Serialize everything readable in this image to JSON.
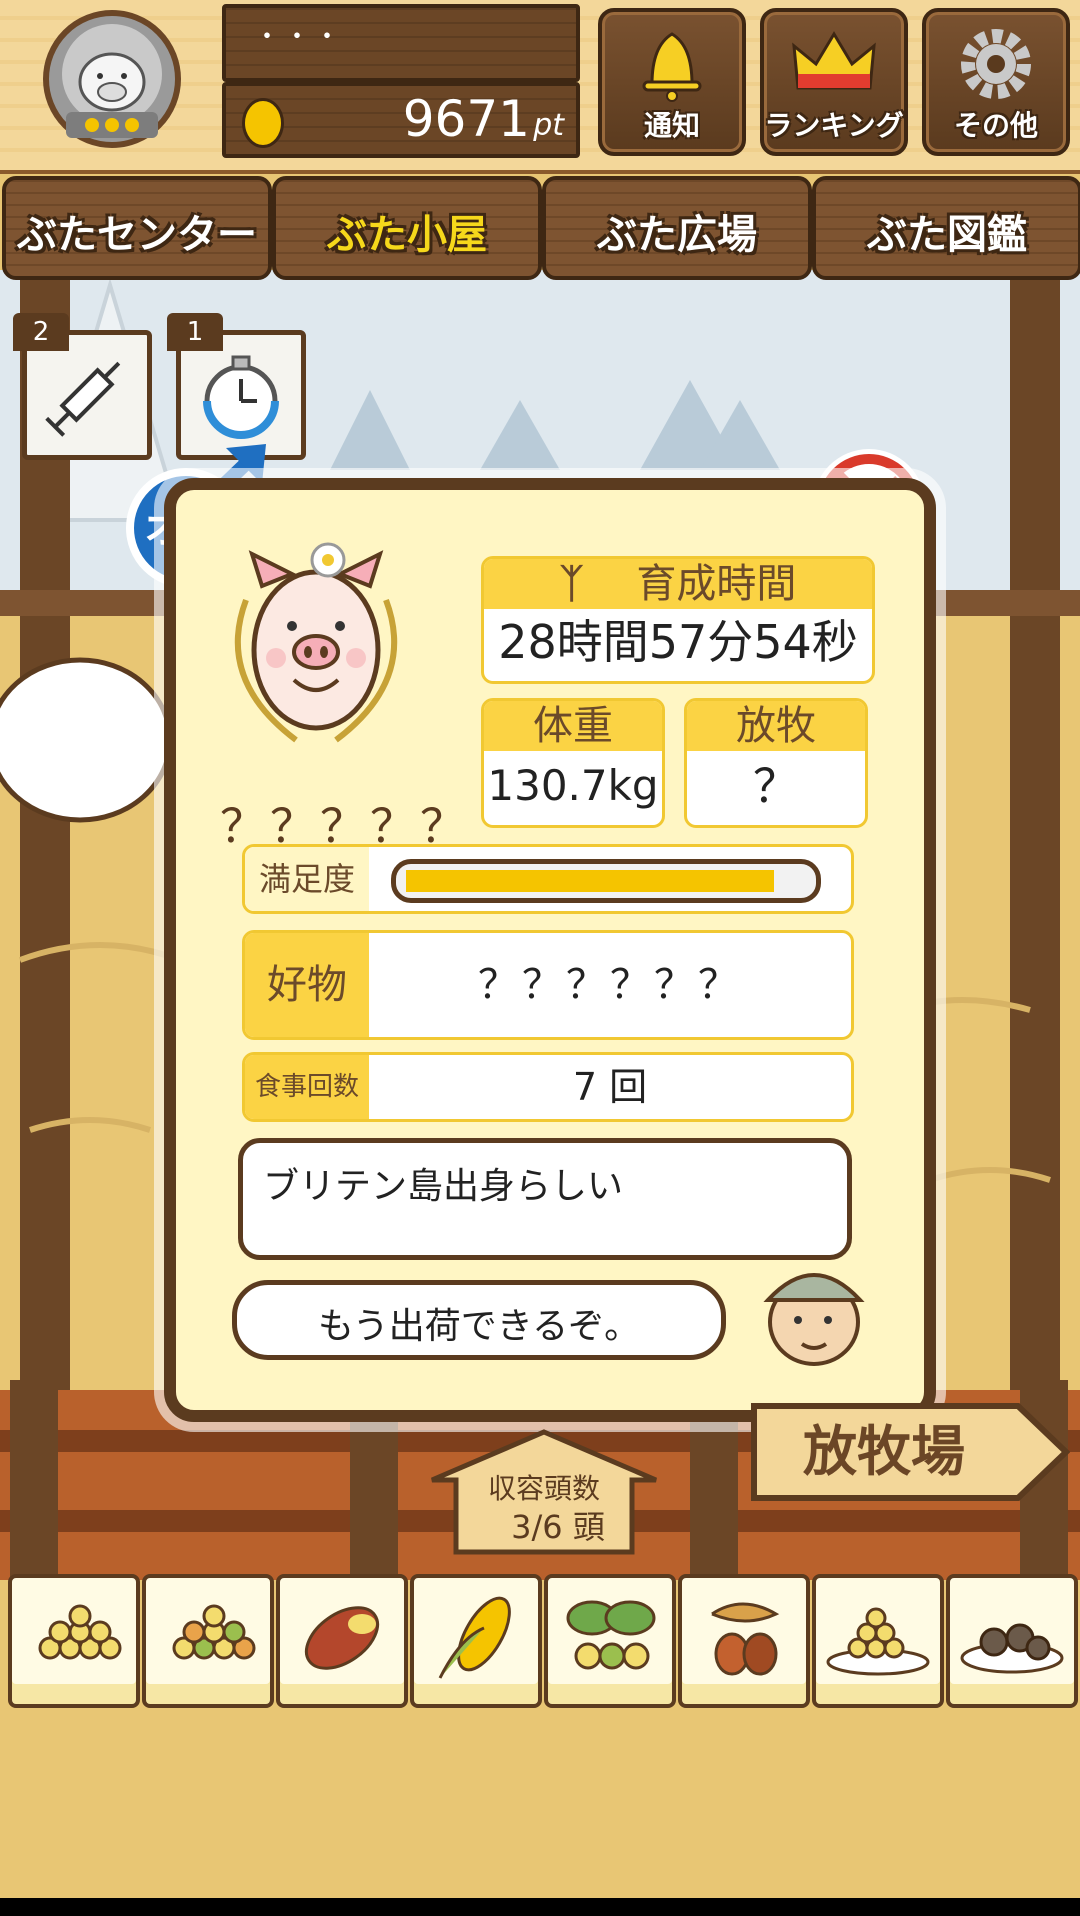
{
  "header": {
    "player_name": "・・・",
    "points": "9671",
    "points_unit": "pt",
    "buttons": [
      {
        "label": "通知",
        "icon": "bell-icon"
      },
      {
        "label": "ランキング",
        "icon": "crown-icon"
      },
      {
        "label": "その他",
        "icon": "gear-icon"
      }
    ]
  },
  "tabs": [
    {
      "label": "ぶたセンター",
      "active": false
    },
    {
      "label": "ぶた小屋",
      "active": true
    },
    {
      "label": "ぶた広場",
      "active": false
    },
    {
      "label": "ぶた図鑑",
      "active": false
    }
  ],
  "items": [
    {
      "icon": "syringe-icon",
      "count": "2"
    },
    {
      "icon": "stopwatch-icon",
      "count": "1"
    }
  ],
  "pig": {
    "gender_label": "オス",
    "name": "？？？？？",
    "growth_time_label": "育成時間",
    "growth_time": "28時間57分54秒",
    "weight_label": "体重",
    "weight": "130.7kg",
    "grazing_label": "放牧",
    "grazing": "？",
    "satisfaction_label": "満足度",
    "satisfaction": 0.92,
    "favorite_label": "好物",
    "favorite": "？？？？？？",
    "meals_label": "食事回数",
    "meals": "7 回",
    "origin_text": "ブリテン島出身らしい",
    "farmer_text": "もう出荷できるぞ。"
  },
  "pen": {
    "capacity_label": "収容頭数",
    "capacity": "3/6 頭",
    "pasture_sign": "放牧場"
  },
  "foods": [
    "feed-pellets-icon",
    "mixed-pellets-icon",
    "sweet-potato-icon",
    "corn-icon",
    "vegetables-icon",
    "acorn-icon",
    "grain-plate-icon",
    "meatball-plate-icon"
  ],
  "colors": {
    "accent": "#fbd344",
    "wood": "#5b3b1f",
    "card": "#fff6c4",
    "male": "#1f6fc1",
    "prohibit": "#d93a2b"
  }
}
